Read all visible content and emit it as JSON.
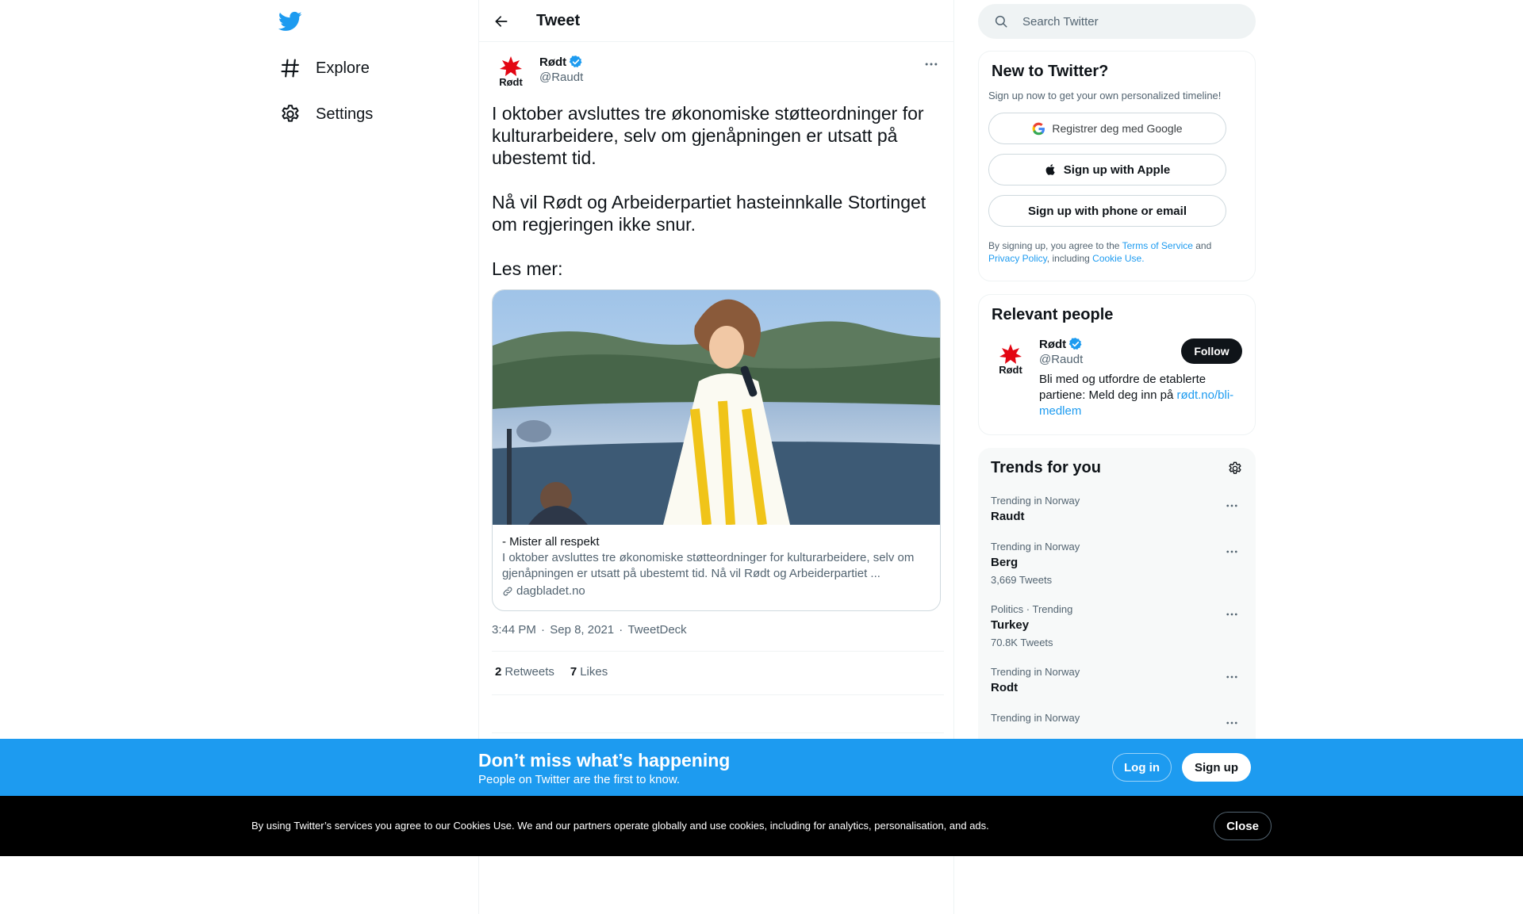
{
  "nav": {
    "items": [
      {
        "label": "Explore",
        "icon": "hashtag-icon"
      },
      {
        "label": "Settings",
        "icon": "gear-icon"
      }
    ]
  },
  "header": {
    "title": "Tweet"
  },
  "tweet": {
    "author_name": "Rødt",
    "author_handle": "@Raudt",
    "text": [
      "I oktober avsluttes tre økonomiske støtteordninger for kulturarbeidere, selv om gjenåpningen er utsatt på ubestemt tid.",
      "Nå vil Rødt og Arbeiderpartiet hasteinnkalle Stortinget om regjeringen ikke snur.",
      "Les mer:"
    ],
    "card": {
      "title": "- Mister all respekt",
      "description": "I oktober avsluttes tre økonomiske støtteordninger for kulturarbeidere, selv om gjenåpningen er utsatt på ubestemt tid. Nå vil Rødt og Arbeiderpartiet ...",
      "domain": "dagbladet.no"
    },
    "time": "3:44 PM",
    "date": "Sep 8, 2021",
    "source": "TweetDeck",
    "retweets_count": "2",
    "retweets_label": "Retweets",
    "likes_count": "7",
    "likes_label": "Likes"
  },
  "search": {
    "placeholder": "Search Twitter"
  },
  "signup_panel": {
    "title": "New to Twitter?",
    "subtitle": "Sign up now to get your own personalized timeline!",
    "google_label": "Registrer deg med Google",
    "apple_label": "Sign up with Apple",
    "phone_label": "Sign up with phone or email",
    "legal_prefix": "By signing up, you agree to the ",
    "terms": "Terms of Service",
    "legal_and": " and ",
    "privacy": "Privacy Policy",
    "legal_including": ", including ",
    "cookie_use": "Cookie Use."
  },
  "people_panel": {
    "title": "Relevant people",
    "name": "Rødt",
    "handle": "@Raudt",
    "bio": "Bli med og utfordre de etablerte partiene: Meld deg inn på ",
    "bio_link": "rødt.no/bli-medlem",
    "follow_label": "Follow"
  },
  "trends_panel": {
    "title": "Trends for you",
    "trends": [
      {
        "context": "Trending in Norway",
        "name": "Raudt",
        "count": ""
      },
      {
        "context": "Trending in Norway",
        "name": "Berg",
        "count": "3,669 Tweets"
      },
      {
        "context": "Politics · Trending",
        "name": "Turkey",
        "count": "70.8K Tweets"
      },
      {
        "context": "Trending in Norway",
        "name": "Rodt",
        "count": ""
      },
      {
        "context": "Trending in Norway",
        "name": "",
        "count": ""
      }
    ]
  },
  "bottom_bar": {
    "title": "Don’t miss what’s happening",
    "subtitle": "People on Twitter are the first to know.",
    "login_label": "Log in",
    "signup_label": "Sign up"
  },
  "cookie_bar": {
    "text": "By using Twitter’s services you agree to our Cookies Use. We and our partners operate globally and use cookies, including for analytics, personalisation, and ads.",
    "close_label": "Close"
  },
  "colors": {
    "brand": "#1d9bf0",
    "text": "#0f1419",
    "secondary": "#536471",
    "rodt_red": "#e30613",
    "cookie_bg": "#000000"
  }
}
